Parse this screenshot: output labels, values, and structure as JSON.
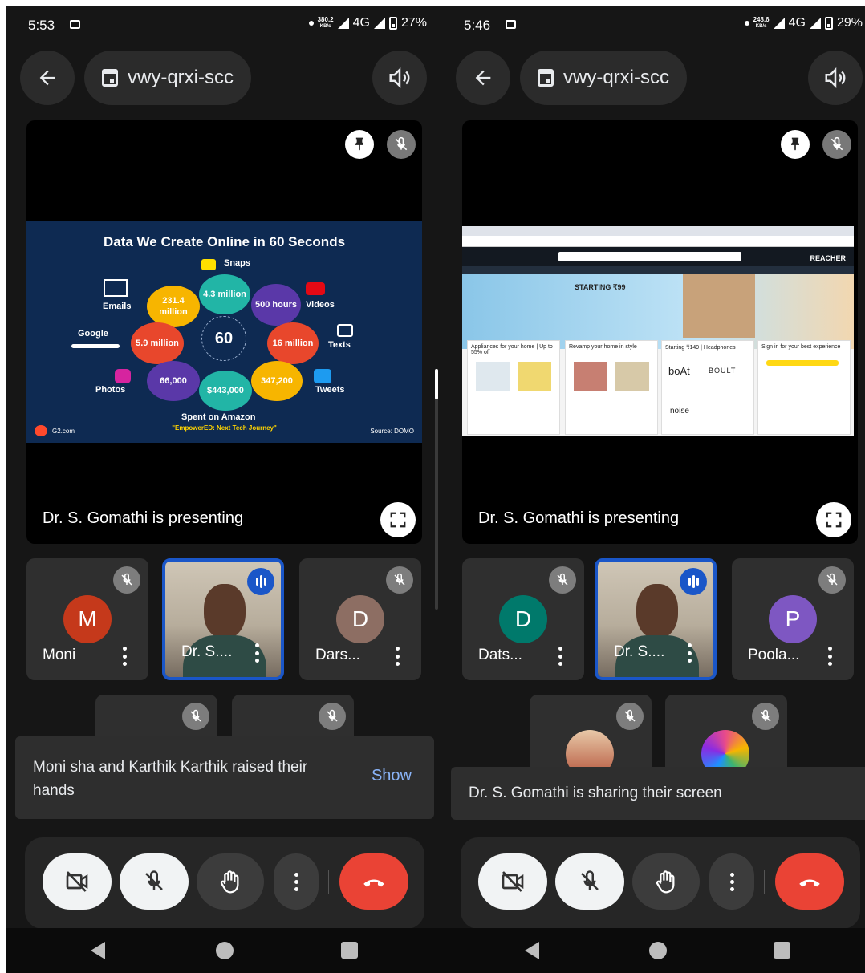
{
  "left": {
    "status": {
      "time": "5:53",
      "net_speed": "380.2",
      "net_unit": "KB/s",
      "network": "4G",
      "battery": "27%"
    },
    "meeting_code": "vwy-qrxi-scc",
    "presenting_caption": "Dr. S. Gomathi is presenting",
    "slide": {
      "title": "Data We Create Online in 60 Seconds",
      "center": "60",
      "snaps": "Snaps",
      "snaps_value": "4.3 million",
      "emails": "Emails",
      "emails_value": "231.4 million",
      "videos_value": "500 hours",
      "videos": "Videos",
      "google": "Google",
      "google_value": "5.9 million",
      "texts_value": "16 million",
      "texts": "Texts",
      "photos": "Photos",
      "photos_value": "66,000",
      "amazon_value": "$443,000",
      "tweets_value": "347,200",
      "tweets": "Tweets",
      "amazon": "Spent on Amazon",
      "footer_left": "G2.com",
      "footer_center": "\"EmpowerED: Next Tech Journey\"",
      "footer_right": "Source: DOMO"
    },
    "participants": [
      {
        "name": "Moni",
        "initial": "M",
        "color": "#c5391b"
      },
      {
        "name": "Dr. S...."
      },
      {
        "name": "Dars...",
        "initial": "D",
        "color": "#8d6e63"
      }
    ],
    "snackbar": {
      "message": "Moni sha and Karthik Karthik raised their hands",
      "action": "Show"
    }
  },
  "right": {
    "status": {
      "time": "5:46",
      "net_speed": "248.6",
      "net_unit": "KB/s",
      "network": "4G",
      "battery": "29%"
    },
    "meeting_code": "vwy-qrxi-scc",
    "presenting_caption": "Dr. S. Gomathi is presenting",
    "browser": {
      "hero_text": "STARTING ₹99",
      "card1": "Appliances for your home | Up to 55% off",
      "card2": "Revamp your home in style",
      "card3": "Starting ₹149 | Headphones",
      "card4": "Sign in for your best experience",
      "brand1": "boAt",
      "brand2": "BOULT",
      "brand3": "noise",
      "nav_right": "REACHER"
    },
    "participants": [
      {
        "name": "Dats...",
        "initial": "D",
        "color": "#00796b"
      },
      {
        "name": "Dr. S...."
      },
      {
        "name": "Poola...",
        "initial": "P",
        "color": "#7e57c2"
      }
    ],
    "snackbar": {
      "message": "Dr. S. Gomathi is sharing their screen"
    }
  },
  "colors": {
    "accent_blue": "#1a56c8",
    "end_call_red": "#ea4335",
    "link": "#8ab4f8"
  },
  "icons": [
    "back-arrow-icon",
    "calendar-icon",
    "speaker-icon",
    "pin-icon",
    "mic-off-icon",
    "fullscreen-icon",
    "more-vert-icon",
    "camera-off-icon",
    "raise-hand-icon",
    "end-call-icon",
    "speaking-icon"
  ]
}
